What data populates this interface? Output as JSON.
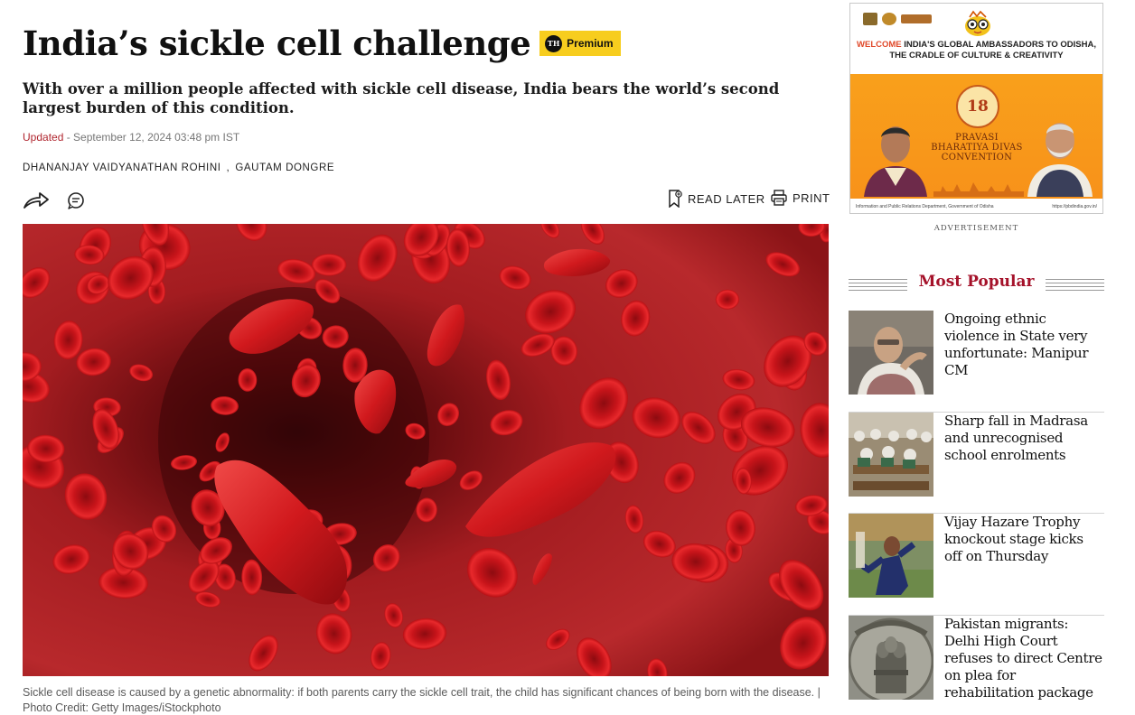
{
  "article": {
    "title": "India’s sickle cell challenge",
    "premium_badge": {
      "logo_text": "TH",
      "label": "Premium",
      "color": "#f7cd1e"
    },
    "subtitle": "With over a million people affected with sickle cell disease, India bears the world’s second largest burden of this condition.",
    "updated_label": "Updated",
    "updated_text": " - September 12, 2024 03:48 pm IST",
    "authors": [
      "DHANANJAY VAIDYANATHAN ROHINI",
      "GAUTAM DONGRE"
    ],
    "author_separator": ",",
    "actions": {
      "read_later": "READ LATER",
      "print": "PRINT"
    },
    "caption": "Sickle cell disease is caused by a genetic abnormality: if both parents carry the sickle cell trait, the child has significant chances of being born with the disease. | Photo Credit: Getty Images/iStockphoto"
  },
  "ad": {
    "headline_welcome": "WELCOME",
    "headline_rest": "INDIA'S GLOBAL AMBASSADORS TO ODISHA,",
    "headline_line2": "THE CRADLE OF CULTURE & CREATIVITY",
    "logo_number": "18",
    "event_line1": "PRAVASI",
    "event_line2": "BHARATIYA DIVAS",
    "event_line3": "CONVENTION",
    "footer_left": "Information and Public Relations Department, Government of Odisha",
    "footer_right": "https://pbdindia.gov.in/",
    "label": "ADVERTISEMENT"
  },
  "most_popular": {
    "heading": "Most Popular",
    "items": [
      {
        "title": "Ongoing ethnic violence in State very unfortunate: Manipur CM"
      },
      {
        "title": "Sharp fall in Madrasa and unrecognised school enrolments"
      },
      {
        "title": "Vijay Hazare Trophy knockout stage kicks off on Thursday"
      },
      {
        "title": "Pakistan migrants: Delhi High Court refuses to direct Centre on plea for rehabilitation package"
      }
    ]
  },
  "colors": {
    "accent_red": "#a5122a",
    "updated_red": "#b0262f",
    "badge_yellow": "#f7cd1e"
  }
}
